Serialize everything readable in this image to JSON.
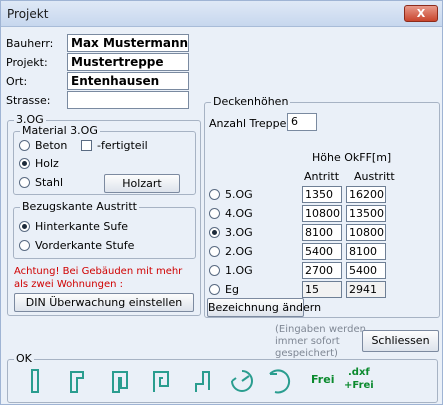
{
  "window": {
    "title": "Projekt",
    "close_label": "X"
  },
  "project": {
    "bauherr_label": "Bauherr:",
    "bauherr": "Max Mustermann",
    "projekt_label": "Projekt:",
    "projekt": "Mustertreppe",
    "ort_label": "Ort:",
    "ort": "Entenhausen",
    "strasse_label": "Strasse:",
    "strasse": ""
  },
  "floor_group": {
    "title": "3.OG",
    "material": {
      "title": "Material 3.OG",
      "beton": "Beton",
      "fertigteil": "-fertigteil",
      "holz": "Holz",
      "stahl": "Stahl",
      "holzart_button": "Holzart",
      "selected": "Holz"
    },
    "bezugskante": {
      "title": "Bezugskante Austritt",
      "hinterkante": "Hinterkante Sufe",
      "vorderkante": "Vorderkante Stufe",
      "selected": "Hinterkante Sufe"
    },
    "warning": "Achtung! Bei Gebäuden mit mehr als zwei Wohnungen :",
    "din_button": "DIN Überwachung einstellen"
  },
  "deckenhoehen": {
    "title": "Deckenhöhen",
    "anzahl_label": "Anzahl Treppen",
    "anzahl": "6",
    "hoehe_label": "Höhe OkFF[m]",
    "col_antritt": "Antritt",
    "col_austritt": "Austritt",
    "rows": [
      {
        "label": "5.OG",
        "antritt": "1350",
        "austritt": "16200",
        "selected": false
      },
      {
        "label": "4.OG",
        "antritt": "10800",
        "austritt": "13500",
        "selected": false
      },
      {
        "label": "3.OG",
        "antritt": "8100",
        "austritt": "10800",
        "selected": true
      },
      {
        "label": "2.OG",
        "antritt": "5400",
        "austritt": "8100",
        "selected": false
      },
      {
        "label": "1.OG",
        "antritt": "2700",
        "austritt": "5400",
        "selected": false
      },
      {
        "label": "Eg",
        "antritt": "15",
        "austritt": "2941",
        "selected": false
      }
    ],
    "bezeichnung_button": "Bezeichnung ändern"
  },
  "footer": {
    "note": "(Eingaben werden immer sofort gespeichert)",
    "schliessen": "Schliessen",
    "ok_title": "OK",
    "frei_label": "Frei",
    "dxf_label": ".dxf",
    "dxf_frei_label": "+Frei"
  },
  "colors": {
    "accent_green": "#0b8a2e",
    "warning_red": "#d00000",
    "icon_teal": "#2a9d8f"
  }
}
